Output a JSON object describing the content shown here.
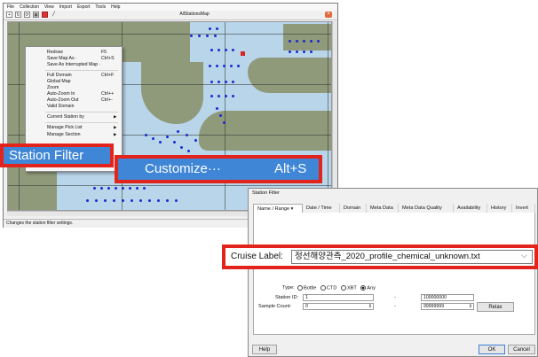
{
  "menu_bar": [
    "File",
    "Collection",
    "View",
    "Import",
    "Export",
    "Tools",
    "Help"
  ],
  "map_tab_title": "AllStationsMap",
  "status_text": "Changes the station filter settings.",
  "context_menu": {
    "items": [
      {
        "label": "Redraw",
        "shortcut": "F5"
      },
      {
        "label": "Save Map As ·",
        "shortcut": "Ctrl+S"
      },
      {
        "label": "Save As Interrupted Map ·",
        "shortcut": ""
      },
      {
        "label": "Full Domain",
        "shortcut": "Ctrl+F"
      },
      {
        "label": "Global Map",
        "shortcut": ""
      },
      {
        "label": "Zoom",
        "shortcut": ""
      },
      {
        "label": "Auto-Zoom In",
        "shortcut": "Ctrl++"
      },
      {
        "label": "Auto-Zoom Out",
        "shortcut": "Ctrl+-"
      },
      {
        "label": "Valid Domain",
        "shortcut": ""
      },
      {
        "label": "Current Station by",
        "shortcut": ""
      },
      {
        "label": "Manage Pick List",
        "shortcut": ""
      },
      {
        "label": "Manage Section",
        "shortcut": ""
      }
    ]
  },
  "callouts": {
    "station_filter": "Station Filter",
    "customize_label": "Customize···",
    "customize_shortcut": "Alt+S"
  },
  "dialog": {
    "title": "Station Filter",
    "tabs": [
      "Name / Range ▾",
      "Date / Time",
      "Domain",
      "Meta Data",
      "Meta Data Quality",
      "Availability",
      "History",
      "Invert"
    ],
    "cruise_label": "Cruise Label:",
    "cruise_value": "정선해양관측_2020_profile_chemical_unknown.txt",
    "type_label": "Type:",
    "type_options": [
      "Bottle",
      "CTD",
      "XBT",
      "Any"
    ],
    "type_selected": "Any",
    "station_id_label": "Station ID:",
    "station_id_min": "1",
    "station_id_max": "100000000",
    "sample_count_label": "Sample Count:",
    "sample_count_min": "0",
    "sample_count_max": "99999999",
    "range_dash": "-",
    "relax_button": "Relax",
    "help_button": "Help",
    "ok_button": "OK",
    "cancel_button": "Cancel"
  },
  "colors": {
    "callout_border": "#e3241c",
    "callout_fill": "#3f86d6",
    "station_dot": "#1a2bd0",
    "land": "#8f9a7a",
    "sea": "#b9d5ea"
  }
}
